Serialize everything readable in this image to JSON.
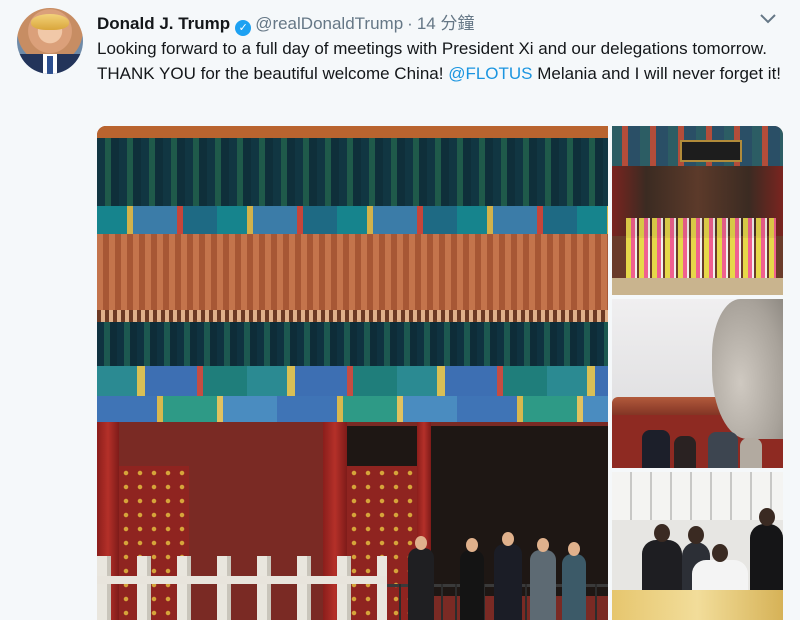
{
  "author": {
    "name": "Donald J. Trump",
    "handle": "@realDonaldTrump",
    "time": "14 分鐘"
  },
  "tweet": {
    "text_main": "Looking forward to a full day of meetings with President Xi and our delegations tomorrow. THANK YOU for the beautiful welcome China! ",
    "mention": "@FLOTUS",
    "text_end": " Melania and I will never forget it!"
  },
  "icons": {
    "verified": "verified-badge-icon",
    "menu": "chevron-down-icon"
  },
  "colors": {
    "link": "#1b95e0",
    "verified": "#1da1f2",
    "secondary_text": "#657786"
  }
}
